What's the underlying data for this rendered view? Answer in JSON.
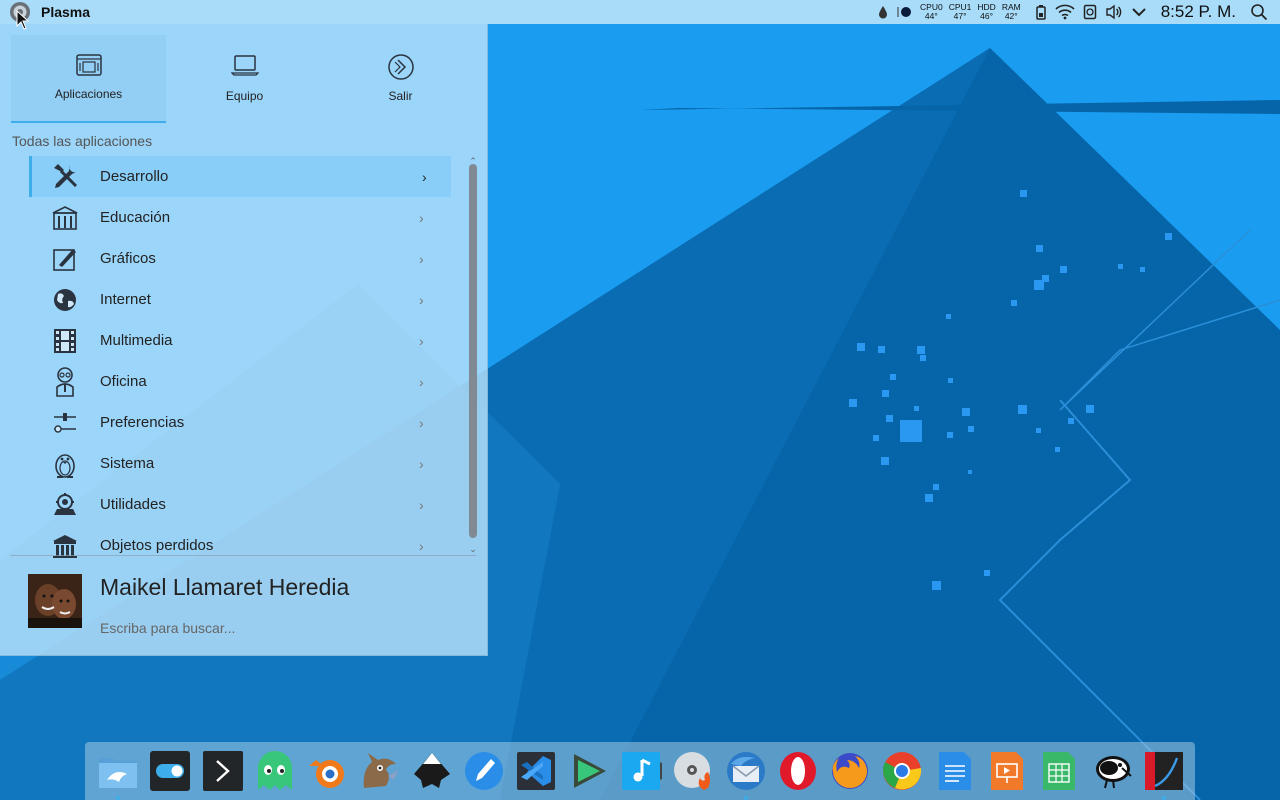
{
  "panel": {
    "app_title": "Plasma",
    "stats": [
      {
        "label": "CPU0",
        "value": "44°"
      },
      {
        "label": "CPU1",
        "value": "47°"
      },
      {
        "label": "HDD",
        "value": "46°"
      },
      {
        "label": "RAM",
        "value": "42°"
      }
    ],
    "clock": "8:52 P. M.",
    "tray_icons": [
      "droplet-icon",
      "moon-icon",
      "battery-icon",
      "wifi-icon",
      "device-icon",
      "volume-icon",
      "chevron-down-icon",
      "search-icon"
    ]
  },
  "menu": {
    "tabs": [
      {
        "label": "Aplicaciones",
        "icon": "applications-icon",
        "active": true
      },
      {
        "label": "Equipo",
        "icon": "laptop-icon",
        "active": false
      },
      {
        "label": "Salir",
        "icon": "exit-icon",
        "active": false
      }
    ],
    "section_title": "Todas las aplicaciones",
    "categories": [
      {
        "label": "Desarrollo",
        "icon": "tools-icon"
      },
      {
        "label": "Educación",
        "icon": "building-icon"
      },
      {
        "label": "Gráficos",
        "icon": "brush-icon"
      },
      {
        "label": "Internet",
        "icon": "globe-icon"
      },
      {
        "label": "Multimedia",
        "icon": "film-icon"
      },
      {
        "label": "Oficina",
        "icon": "office-person-icon"
      },
      {
        "label": "Preferencias",
        "icon": "sliders-icon"
      },
      {
        "label": "Sistema",
        "icon": "penguin-icon"
      },
      {
        "label": "Utilidades",
        "icon": "utilities-icon"
      },
      {
        "label": "Objetos perdidos",
        "icon": "lost-found-icon"
      }
    ],
    "arrow": "›",
    "user_name": "Maikel Llamaret Heredia",
    "search_hint": "Escriba para buscar..."
  },
  "dock": {
    "apps": [
      {
        "name": "dolphin-file-manager-icon",
        "running": true
      },
      {
        "name": "settings-toggle-icon",
        "running": false
      },
      {
        "name": "terminal-icon",
        "running": false
      },
      {
        "name": "ghost-app-icon",
        "running": false
      },
      {
        "name": "blender-icon",
        "running": false
      },
      {
        "name": "gimp-icon",
        "running": false
      },
      {
        "name": "inkscape-icon",
        "running": false
      },
      {
        "name": "pen-editor-icon",
        "running": false
      },
      {
        "name": "vscode-icon",
        "running": false
      },
      {
        "name": "play-arrow-icon",
        "running": false
      },
      {
        "name": "music-player-icon",
        "running": false
      },
      {
        "name": "disc-burner-icon",
        "running": false
      },
      {
        "name": "thunderbird-icon",
        "running": true
      },
      {
        "name": "opera-icon",
        "running": false
      },
      {
        "name": "firefox-icon",
        "running": false
      },
      {
        "name": "chrome-icon",
        "running": false
      },
      {
        "name": "text-document-icon",
        "running": false
      },
      {
        "name": "presentation-icon",
        "running": false
      },
      {
        "name": "spreadsheet-icon",
        "running": false
      },
      {
        "name": "kiwi-icon",
        "running": false
      },
      {
        "name": "graph-tool-icon",
        "running": true
      }
    ]
  },
  "colors": {
    "accent": "#3daee9",
    "wallpaper_light": "#1a9cf0",
    "wallpaper_dark": "#0664a8",
    "panel": "#a8dcf9"
  }
}
